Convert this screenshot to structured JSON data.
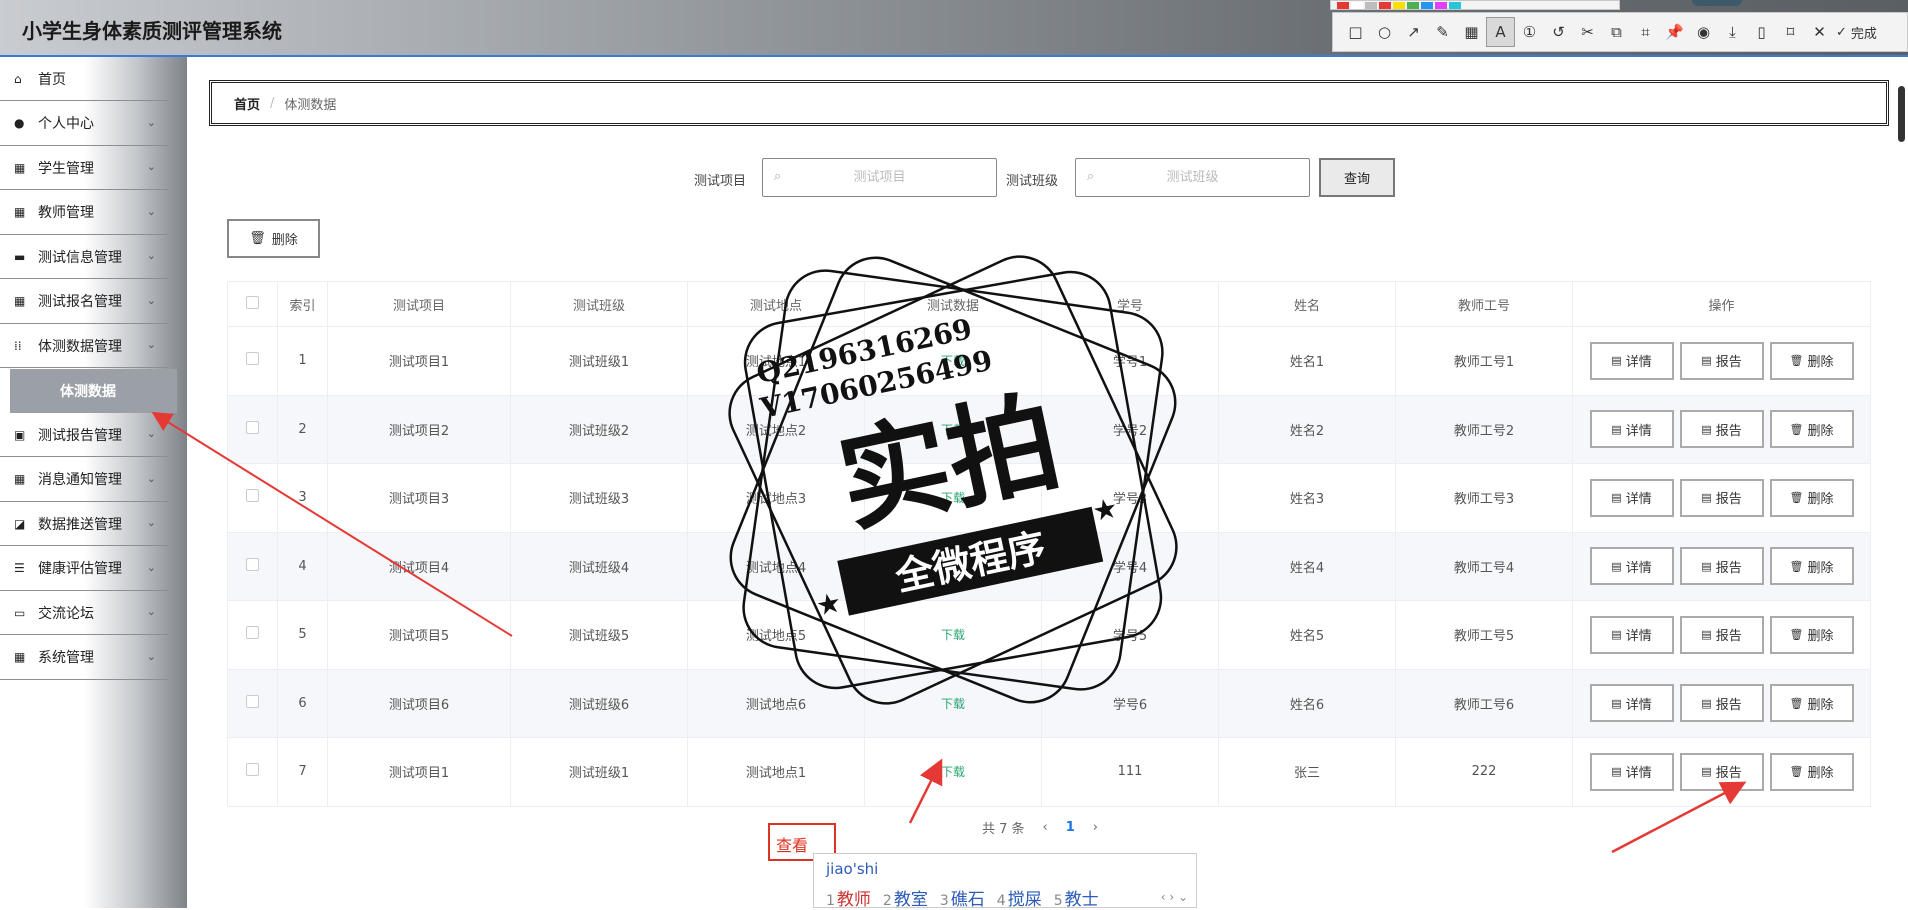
{
  "app": {
    "title": "小学生身体素质测评管理系统"
  },
  "screenshot_tool": {
    "done_label": "完成",
    "colors": [
      "#e53935",
      "#ffffff",
      "#bdbdbd",
      "#e53935",
      "#f9e000",
      "#4caf50",
      "#2196f3",
      "#e040fb",
      "#26c6da"
    ]
  },
  "sidebar": {
    "items": [
      {
        "label": "首页",
        "icon": "home-icon",
        "has_children": false
      },
      {
        "label": "个人中心",
        "icon": "user-icon",
        "has_children": true
      },
      {
        "label": "学生管理",
        "icon": "grid-icon",
        "has_children": true
      },
      {
        "label": "教师管理",
        "icon": "grid-icon",
        "has_children": true
      },
      {
        "label": "测试信息管理",
        "icon": "printer-icon",
        "has_children": true
      },
      {
        "label": "测试报名管理",
        "icon": "grid-icon",
        "has_children": true
      },
      {
        "label": "体测数据管理",
        "icon": "grid9-icon",
        "has_children": true
      },
      {
        "label": "测试报告管理",
        "icon": "clipboard-icon",
        "has_children": true
      },
      {
        "label": "消息通知管理",
        "icon": "grid-icon",
        "has_children": true
      },
      {
        "label": "数据推送管理",
        "icon": "chart-icon",
        "has_children": true
      },
      {
        "label": "健康评估管理",
        "icon": "sliders-icon",
        "has_children": true
      },
      {
        "label": "交流论坛",
        "icon": "chat-icon",
        "has_children": true
      },
      {
        "label": "系统管理",
        "icon": "grid-icon",
        "has_children": true
      }
    ],
    "active_sub": "体测数据"
  },
  "breadcrumb": {
    "home": "首页",
    "separator": "/",
    "current": "体测数据"
  },
  "search": {
    "item_label": "测试项目",
    "item_placeholder": "测试项目",
    "class_label": "测试班级",
    "class_placeholder": "测试班级",
    "query_button": "查询"
  },
  "toolbar": {
    "delete_label": "删除"
  },
  "table": {
    "headers": [
      "索引",
      "测试项目",
      "测试班级",
      "测试地点",
      "测试数据",
      "学号",
      "姓名",
      "教师工号",
      "操作"
    ],
    "rows": [
      {
        "index": "1",
        "item": "测试项目1",
        "class": "测试班级1",
        "place": "测试地点1",
        "data": "下载",
        "sid": "学号1",
        "name": "姓名1",
        "tid": "教师工号1"
      },
      {
        "index": "2",
        "item": "测试项目2",
        "class": "测试班级2",
        "place": "测试地点2",
        "data": "下载",
        "sid": "学号2",
        "name": "姓名2",
        "tid": "教师工号2"
      },
      {
        "index": "3",
        "item": "测试项目3",
        "class": "测试班级3",
        "place": "测试地点3",
        "data": "下载",
        "sid": "学号3",
        "name": "姓名3",
        "tid": "教师工号3"
      },
      {
        "index": "4",
        "item": "测试项目4",
        "class": "测试班级4",
        "place": "测试地点4",
        "data": "下载",
        "sid": "学号4",
        "name": "姓名4",
        "tid": "教师工号4"
      },
      {
        "index": "5",
        "item": "测试项目5",
        "class": "测试班级5",
        "place": "测试地点5",
        "data": "下载",
        "sid": "学号5",
        "name": "姓名5",
        "tid": "教师工号5"
      },
      {
        "index": "6",
        "item": "测试项目6",
        "class": "测试班级6",
        "place": "测试地点6",
        "data": "下载",
        "sid": "学号6",
        "name": "姓名6",
        "tid": "教师工号6"
      },
      {
        "index": "7",
        "item": "测试项目1",
        "class": "测试班级1",
        "place": "测试地点1",
        "data": "下载",
        "sid": "111",
        "name": "张三",
        "tid": "222"
      }
    ],
    "actions": {
      "detail": "详情",
      "report": "报告",
      "delete": "删除"
    }
  },
  "pagination": {
    "total_text": "共 7 条",
    "current_page": "1",
    "prev": "‹",
    "next": "›"
  },
  "annotation": {
    "box_text": "查看"
  },
  "ime": {
    "input": "jiao'shi",
    "candidates": [
      {
        "n": "1",
        "text": "教师"
      },
      {
        "n": "2",
        "text": "教室"
      },
      {
        "n": "3",
        "text": "礁石"
      },
      {
        "n": "4",
        "text": "搅屎"
      },
      {
        "n": "5",
        "text": "教士"
      }
    ],
    "nav": "‹ › ⌄"
  },
  "watermark": {
    "line1": "Q2196316269",
    "line2": "V17060256499",
    "big": "实拍",
    "banner": "全微程序"
  }
}
